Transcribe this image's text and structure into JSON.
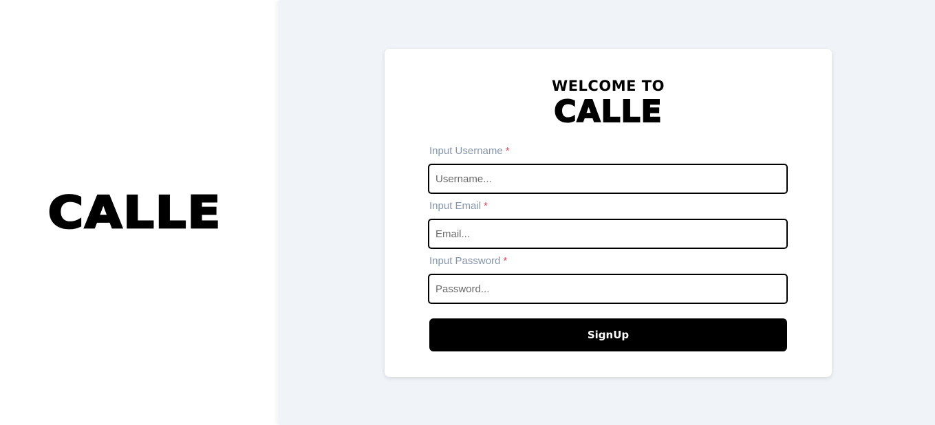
{
  "brand": {
    "logo_text": "CALLE"
  },
  "signup_card": {
    "welcome_text": "WELCOME TO",
    "logo_text": "CALLE",
    "fields": [
      {
        "label": "Input Username",
        "required_mark": "*",
        "placeholder": "Username...",
        "value": ""
      },
      {
        "label": "Input Email",
        "required_mark": "*",
        "placeholder": "Email...",
        "value": ""
      },
      {
        "label": "Input Password",
        "required_mark": "*",
        "placeholder": "Password...",
        "value": ""
      }
    ],
    "submit_label": "SignUp"
  },
  "colors": {
    "page_background": "#f0f3f7",
    "card_background": "#ffffff",
    "label_color": "#8494ae",
    "required_color": "#e0485b",
    "button_background": "#000000",
    "button_text": "#ffffff"
  }
}
